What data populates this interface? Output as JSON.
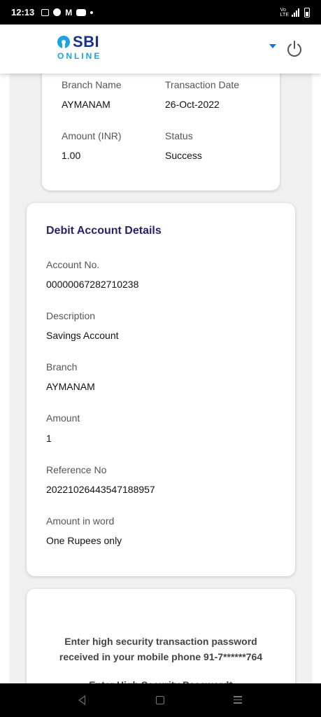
{
  "status_bar": {
    "time": "12:13",
    "notification_icons": [
      "message-icon",
      "circle-app-icon",
      "gmail-icon",
      "youtube-icon",
      "dot-icon"
    ],
    "right_icons": [
      "volte-icon",
      "signal-icon",
      "battery-icon"
    ]
  },
  "header": {
    "logo_sbi": "SBI",
    "logo_online": "ONLINE",
    "brand_colors": {
      "navy": "#1b2f8f",
      "sky": "#1aa5e1"
    }
  },
  "transaction": {
    "branch_name_label": "Branch Name",
    "branch_name_value": "AYMANAM",
    "transaction_date_label": "Transaction Date",
    "transaction_date_value": "26-Oct-2022",
    "amount_label": "Amount (INR)",
    "amount_value": "1.00",
    "status_label": "Status",
    "status_value": "Success"
  },
  "debit": {
    "title": "Debit Account Details",
    "account_no_label": "Account No.",
    "account_no_value": "00000067282710238",
    "description_label": "Description",
    "description_value": "Savings Account",
    "branch_label": "Branch",
    "branch_value": "AYMANAM",
    "amount_label": "Amount",
    "amount_value": "1",
    "reference_label": "Reference No",
    "reference_value": "20221026443547188957",
    "amount_word_label": "Amount in word",
    "amount_word_value": "One Rupees only"
  },
  "otp": {
    "line1": "Enter high security transaction password",
    "line2": "received in your mobile phone 91-7******764",
    "field_label": "Enter High Security Password*"
  },
  "nav_bar": {
    "icons": [
      "back-icon",
      "home-icon",
      "recent-apps-icon"
    ]
  }
}
